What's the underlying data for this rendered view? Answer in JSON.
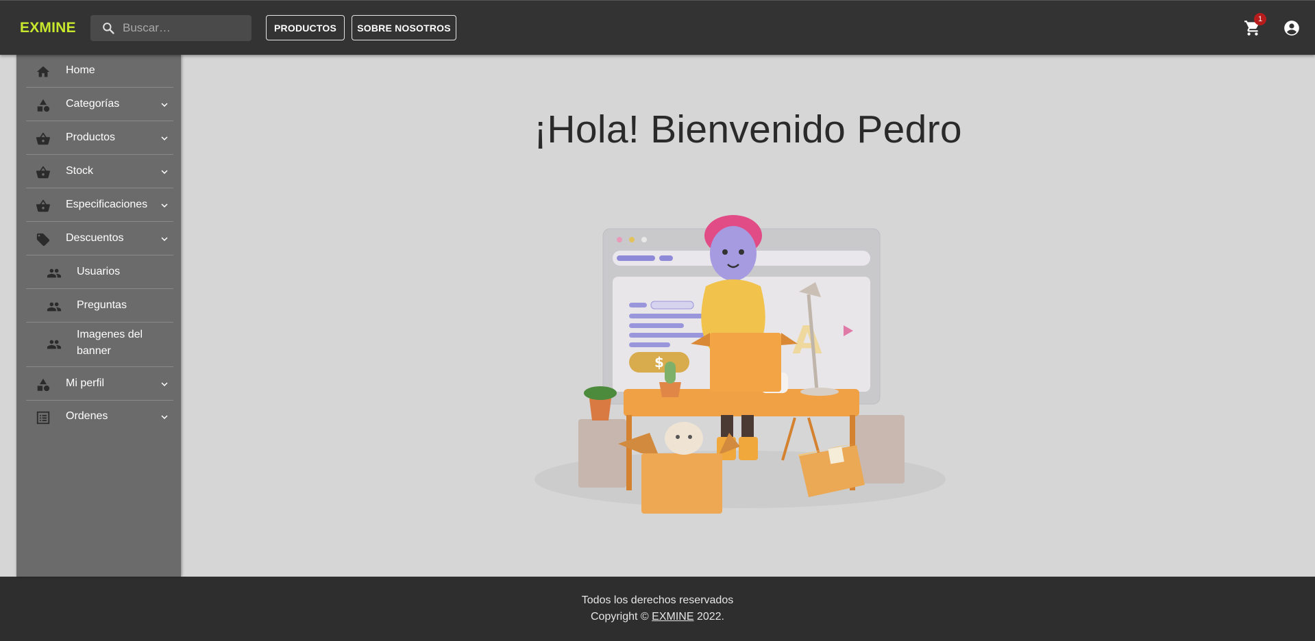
{
  "header": {
    "brand": "EXMINE",
    "search_placeholder": "Buscar…",
    "nav": {
      "productos": "PRODUCTOS",
      "sobre": "SOBRE NOSOTROS"
    },
    "cart_count": "1",
    "icons": [
      "search-icon",
      "cart-icon",
      "account-icon"
    ]
  },
  "sidebar": {
    "items": [
      {
        "label": "Home",
        "icon": "home-icon"
      },
      {
        "label": "Categorías",
        "icon": "category-icon"
      },
      {
        "label": "Productos",
        "icon": "basket-icon"
      },
      {
        "label": "Stock",
        "icon": "basket-icon"
      },
      {
        "label": "Especificaciones",
        "icon": "basket-icon"
      },
      {
        "label": "Descuentos",
        "icon": "tag-icon"
      },
      {
        "label": "Usuarios",
        "icon": "people-icon"
      },
      {
        "label": "Preguntas",
        "icon": "people-icon"
      },
      {
        "label": "Imagenes del banner",
        "icon": "people-icon"
      },
      {
        "label": "Mi perfil",
        "icon": "category-icon"
      },
      {
        "label": "Ordenes",
        "icon": "list-icon"
      }
    ]
  },
  "main": {
    "greeting": "¡Hola! Bienvenido Pedro",
    "hero_dollar": "$",
    "hero_letter": "A"
  },
  "footer": {
    "line1": "Todos los derechos reservados",
    "copyright_prefix": "Copyright © ",
    "brand": "EXMINE",
    "copyright_suffix": " 2022."
  },
  "colors": {
    "header_bg": "#333333",
    "brand": "#c8e82e",
    "sidebar_bg": "#6b6b6b",
    "main_bg": "#d6d6d6",
    "footer_bg": "#2e2e2e",
    "badge": "#b71c1c"
  }
}
